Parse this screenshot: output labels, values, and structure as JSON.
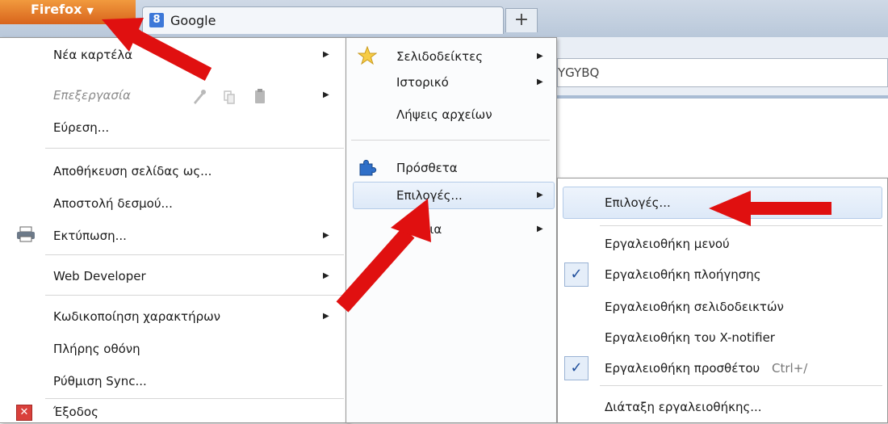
{
  "browser": {
    "firefox_button": "Firefox",
    "tab_title": "Google",
    "tab_favicon": "8",
    "new_tab": "+",
    "url_fragment": "YGYBQ"
  },
  "main_menu": {
    "items": [
      {
        "label": "Νέα καρτέλα"
      },
      {
        "label": "Επεξεργασία"
      },
      {
        "label": "Εύρεση..."
      },
      {
        "label": "Αποθήκευση σελίδας ως..."
      },
      {
        "label": "Αποστολή δεσμού..."
      },
      {
        "label": "Εκτύπωση..."
      },
      {
        "label": "Web Developer"
      },
      {
        "label": "Κωδικοποίηση χαρακτήρων"
      },
      {
        "label": "Πλήρης οθόνη"
      },
      {
        "label": "Ρύθμιση Sync..."
      },
      {
        "label": "Έξοδος"
      }
    ]
  },
  "sub_menu": {
    "items": [
      {
        "label": "Σελιδοδείκτες"
      },
      {
        "label": "Ιστορικό"
      },
      {
        "label": "Λήψεις αρχείων"
      },
      {
        "label": "Πρόσθετα"
      },
      {
        "label": "Επιλογές..."
      },
      {
        "label": "θεια"
      }
    ]
  },
  "options_menu": {
    "items": [
      {
        "label": "Επιλογές..."
      },
      {
        "label": "Εργαλειοθήκη μενού"
      },
      {
        "label": "Εργαλειοθήκη πλοήγησης",
        "checked": true
      },
      {
        "label": "Εργαλειοθήκη σελιδοδεικτών"
      },
      {
        "label": "Εργαλειοθήκη του X-notifier"
      },
      {
        "label": "Εργαλειοθήκη προσθέτου",
        "checked": true,
        "shortcut": "Ctrl+/"
      },
      {
        "label": "Διάταξη εργαλειοθήκης..."
      }
    ]
  },
  "colors": {
    "firefox_orange": "#e07a2b",
    "arrow_red": "#e01010",
    "highlight_blue": "#dde9f8",
    "check_blue": "#1e4d9b"
  }
}
